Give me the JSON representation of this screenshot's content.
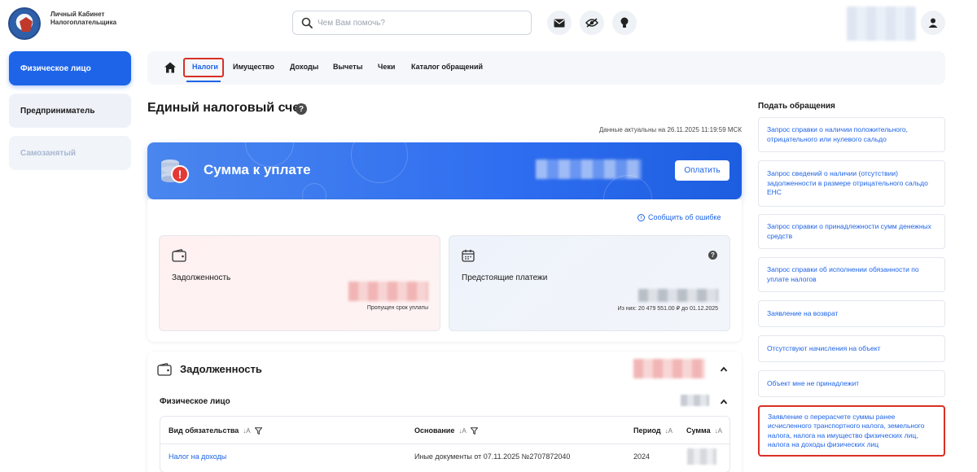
{
  "header": {
    "logo_text": "Личный Кабинет Налогоплательщика",
    "search_placeholder": "Чем Вам помочь?"
  },
  "left_nav": [
    {
      "label": "Физическое лицо",
      "state": "active"
    },
    {
      "label": "Предприниматель",
      "state": "normal"
    },
    {
      "label": "Самозанятый",
      "state": "disabled"
    }
  ],
  "tabs": [
    "Налоги",
    "Имущество",
    "Доходы",
    "Вычеты",
    "Чеки",
    "Каталог обращений"
  ],
  "main": {
    "title": "Единый налоговый счет",
    "data_actual": "Данные актуальны на 26.11.2025 11:19:59 МСК",
    "banner_title": "Сумма к уплате",
    "pay_button": "Оплатить",
    "report_link": "Сообщить об ошибке",
    "debt_card": {
      "label": "Задолженность",
      "note": "Пропущен срок уплаты"
    },
    "upcoming_card": {
      "label": "Предстоящие платежи",
      "note": "Из них: 20 479 551.00 ₽ до 01.12.2025"
    }
  },
  "debt_section": {
    "title": "Задолженность",
    "subsection": "Физическое лицо",
    "columns": [
      "Вид обязательства",
      "Основание",
      "Период",
      "Сумма"
    ],
    "rows": [
      {
        "type": "Налог на доходы",
        "basis": "Иные документы от 07.11.2025 №2707872040",
        "period": "2024"
      }
    ]
  },
  "right_panel": {
    "title": "Подать обращения",
    "items": [
      "Запрос справки о наличии положительного, отрицательного или нулевого сальдо",
      "Запрос сведений о наличии (отсутствии) задолженности в размере отрицательного сальдо ЕНС",
      "Запрос справки о принадлежности сумм денежных средств",
      "Запрос справки об исполнении обязанности по уплате налогов",
      "Заявление на возврат",
      "Отсутствуют начисления на объект",
      "Объект мне не принадлежит",
      "Заявление о перерасчете суммы ранее исчисленного транспортного налога, земельного налога, налога на имущество физических лиц, налога на доходы физических лиц"
    ]
  },
  "colors": {
    "accent": "#1e64e8",
    "alert": "#e53935",
    "highlight": "#d93025"
  }
}
